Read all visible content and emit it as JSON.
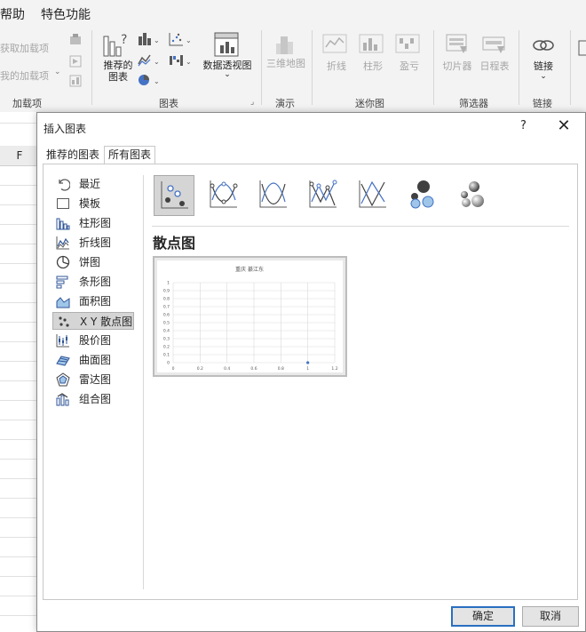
{
  "menubar": {
    "items": [
      "帮助",
      "特色功能"
    ]
  },
  "ribbon": {
    "addins": {
      "get_addins": "获取加载项",
      "my_addins": "我的加载项",
      "group_label": "加载项"
    },
    "charts": {
      "recommended": "推荐的图表",
      "pivot_chart": "数据透视图",
      "group_label": "图表"
    },
    "tours": {
      "map3d": "三维地图",
      "group_label": "演示"
    },
    "sparklines": {
      "line": "折线",
      "column": "柱形",
      "winloss": "盈亏",
      "group_label": "迷你图"
    },
    "filters": {
      "slicer": "切片器",
      "timeline": "日程表",
      "group_label": "筛选器"
    },
    "links": {
      "link": "链接",
      "group_label": "链接"
    }
  },
  "sheet": {
    "column_header": "F"
  },
  "dialog": {
    "title": "插入图表",
    "help": "?",
    "close": "✕",
    "tabs": [
      "推荐的图表",
      "所有图表"
    ],
    "active_tab": "所有图表",
    "categories": [
      {
        "label": "最近",
        "icon": "recent-icon"
      },
      {
        "label": "模板",
        "icon": "template-icon"
      },
      {
        "label": "柱形图",
        "icon": "column-chart-icon"
      },
      {
        "label": "折线图",
        "icon": "line-chart-icon"
      },
      {
        "label": "饼图",
        "icon": "pie-chart-icon"
      },
      {
        "label": "条形图",
        "icon": "bar-chart-icon"
      },
      {
        "label": "面积图",
        "icon": "area-chart-icon"
      },
      {
        "label": "X Y 散点图",
        "icon": "scatter-chart-icon"
      },
      {
        "label": "股价图",
        "icon": "stock-chart-icon"
      },
      {
        "label": "曲面图",
        "icon": "surface-chart-icon"
      },
      {
        "label": "雷达图",
        "icon": "radar-chart-icon"
      },
      {
        "label": "组合图",
        "icon": "combo-chart-icon"
      }
    ],
    "selected_category": "X Y 散点图",
    "subtypes": [
      "scatter",
      "scatter-smooth-markers",
      "scatter-smooth",
      "scatter-straight-markers",
      "scatter-straight",
      "bubble",
      "bubble-3d"
    ],
    "selected_subtype": "scatter",
    "chart_heading": "散点图",
    "ok": "确定",
    "cancel": "取消"
  },
  "chart_data": {
    "type": "scatter",
    "title": "重庆 綦江东",
    "xlabel": "",
    "ylabel": "",
    "x_ticks": [
      "0",
      "0.2",
      "0.4",
      "0.6",
      "0.8",
      "1",
      "1.2"
    ],
    "y_ticks": [
      "0",
      "0.1",
      "0.2",
      "0.3",
      "0.4",
      "0.5",
      "0.6",
      "0.7",
      "0.8",
      "0.9",
      "1"
    ],
    "xlim": [
      0,
      1.2
    ],
    "ylim": [
      0,
      1
    ],
    "points": [
      {
        "x": 1,
        "y": 0
      }
    ],
    "grid": true,
    "colors": {
      "marker": "#4472c4"
    }
  }
}
